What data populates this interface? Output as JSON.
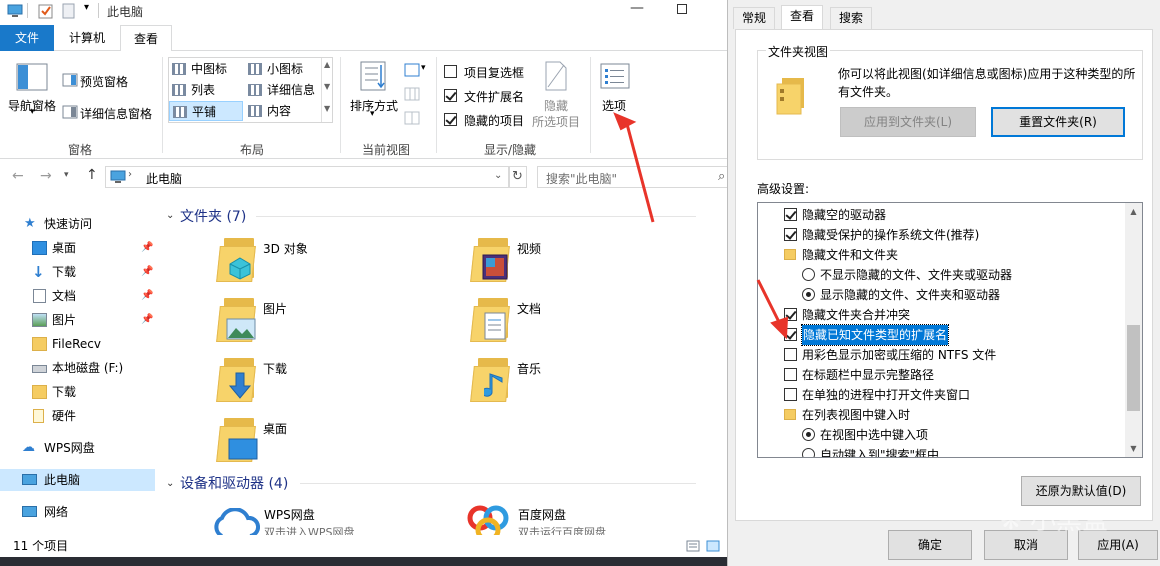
{
  "window": {
    "title": "此电脑"
  },
  "ribbon": {
    "tabs": [
      "文件",
      "计算机",
      "查看"
    ],
    "pane": {
      "nav_pane": "导航窗格",
      "preview": "预览窗格",
      "details": "详细信息窗格",
      "group": "窗格"
    },
    "layout": {
      "items": [
        "中图标",
        "小图标",
        "列表",
        "详细信息",
        "平铺",
        "内容"
      ],
      "selected": "平铺",
      "group": "布局"
    },
    "current_view": {
      "sort": "排序方式",
      "group": "当前视图"
    },
    "show_hide": {
      "item_checkboxes": "项目复选框",
      "file_extensions": "文件扩展名",
      "hidden_items": "隐藏的项目",
      "hide_selected_1": "隐藏",
      "hide_selected_2": "所选项目",
      "group": "显示/隐藏",
      "item_checkboxes_checked": false,
      "file_extensions_checked": true,
      "hidden_items_checked": true
    },
    "options": "选项"
  },
  "address": {
    "path": "此电脑",
    "search_placeholder": "搜索\"此电脑\""
  },
  "nav": {
    "quick_access": "快速访问",
    "items": [
      "桌面",
      "下载",
      "文档",
      "图片",
      "FileRecv",
      "本地磁盘 (F:)",
      "下载",
      "硬件"
    ],
    "wps": "WPS网盘",
    "this_pc": "此电脑",
    "network": "网络"
  },
  "content": {
    "folders_header": "文件夹 (7)",
    "folders": [
      "3D 对象",
      "视频",
      "图片",
      "文档",
      "下载",
      "音乐",
      "桌面"
    ],
    "devices_header": "设备和驱动器 (4)",
    "devices": [
      {
        "name": "WPS网盘",
        "desc": "双击进入WPS网盘"
      },
      {
        "name": "百度网盘",
        "desc": "双击运行百度网盘"
      }
    ]
  },
  "status": {
    "count": "11 个项目"
  },
  "dialog": {
    "tabs": [
      "常规",
      "查看",
      "搜索"
    ],
    "active_tab": "查看",
    "folder_views": {
      "title": "文件夹视图",
      "desc_1": "你可以将此视图(如详细信息或图标)应用于这种类型的所",
      "desc_2": "有文件夹。",
      "apply": "应用到文件夹(L)",
      "reset": "重置文件夹(R)"
    },
    "advanced_label": "高级设置:",
    "advanced": [
      {
        "kind": "check",
        "checked": true,
        "indent": 0,
        "text": "隐藏空的驱动器"
      },
      {
        "kind": "check",
        "checked": true,
        "indent": 0,
        "text": "隐藏受保护的操作系统文件(推荐)"
      },
      {
        "kind": "folder",
        "indent": 0,
        "text": "隐藏文件和文件夹"
      },
      {
        "kind": "radio",
        "checked": false,
        "indent": 1,
        "text": "不显示隐藏的文件、文件夹或驱动器"
      },
      {
        "kind": "radio",
        "checked": true,
        "indent": 1,
        "text": "显示隐藏的文件、文件夹和驱动器"
      },
      {
        "kind": "check",
        "checked": true,
        "indent": 0,
        "text": "隐藏文件夹合并冲突"
      },
      {
        "kind": "check",
        "checked": true,
        "indent": 0,
        "text": "隐藏已知文件类型的扩展名",
        "highlight": true
      },
      {
        "kind": "check",
        "checked": false,
        "indent": 0,
        "text": "用彩色显示加密或压缩的 NTFS 文件"
      },
      {
        "kind": "check",
        "checked": false,
        "indent": 0,
        "text": "在标题栏中显示完整路径"
      },
      {
        "kind": "check",
        "checked": false,
        "indent": 0,
        "text": "在单独的进程中打开文件夹窗口"
      },
      {
        "kind": "folder",
        "indent": 0,
        "text": "在列表视图中键入时"
      },
      {
        "kind": "radio",
        "checked": true,
        "indent": 1,
        "text": "在视图中选中键入项"
      },
      {
        "kind": "radio",
        "checked": false,
        "indent": 1,
        "text": "自动键入到\"搜索\"框中"
      }
    ],
    "restore_defaults": "还原为默认值(D)",
    "ok": "确定",
    "cancel": "取消",
    "apply": "应用(A)"
  },
  "colors": {
    "accent": "#1979ca",
    "selection": "#cce8ff",
    "highlight": "#0078d7",
    "annotation_arrow": "#e8342a"
  }
}
